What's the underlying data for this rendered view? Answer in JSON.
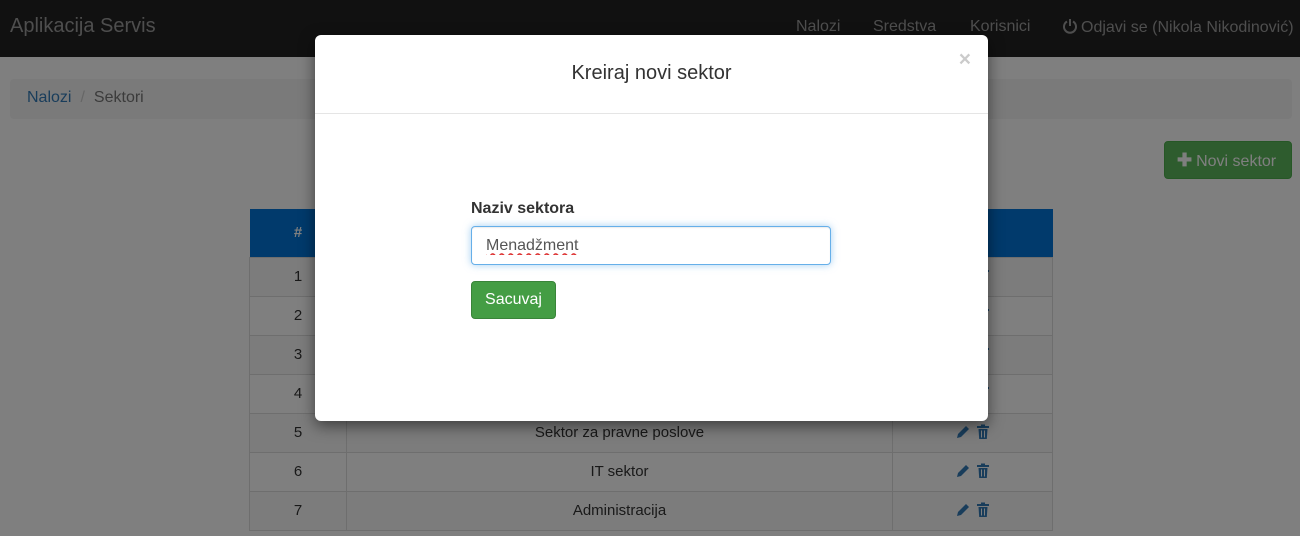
{
  "navbar": {
    "brand": "Aplikacija Servis",
    "links": [
      "Nalozi",
      "Sredstva",
      "Korisnici"
    ],
    "logout_label": "Odjavi se (Nikola Nikodinović)"
  },
  "breadcrumb": {
    "parent": "Nalozi",
    "separator": "/",
    "current": "Sektori"
  },
  "new_sector_button": "Novi sektor",
  "table": {
    "headers": [
      "#",
      "",
      ""
    ],
    "rows": [
      {
        "num": "1",
        "name": ""
      },
      {
        "num": "2",
        "name": ""
      },
      {
        "num": "3",
        "name": ""
      },
      {
        "num": "4",
        "name": ""
      },
      {
        "num": "5",
        "name": "Sektor za pravne poslove"
      },
      {
        "num": "6",
        "name": "IT sektor"
      },
      {
        "num": "7",
        "name": "Administracija"
      }
    ]
  },
  "modal": {
    "title": "Kreiraj novi sektor",
    "close": "×",
    "field_label": "Naziv sektora",
    "field_value": "Menadžment",
    "save_label": "Sacuvaj"
  },
  "colors": {
    "navbar_bg": "#222222",
    "table_header": "#0275d8",
    "success": "#5cb85c",
    "link": "#337ab7"
  }
}
